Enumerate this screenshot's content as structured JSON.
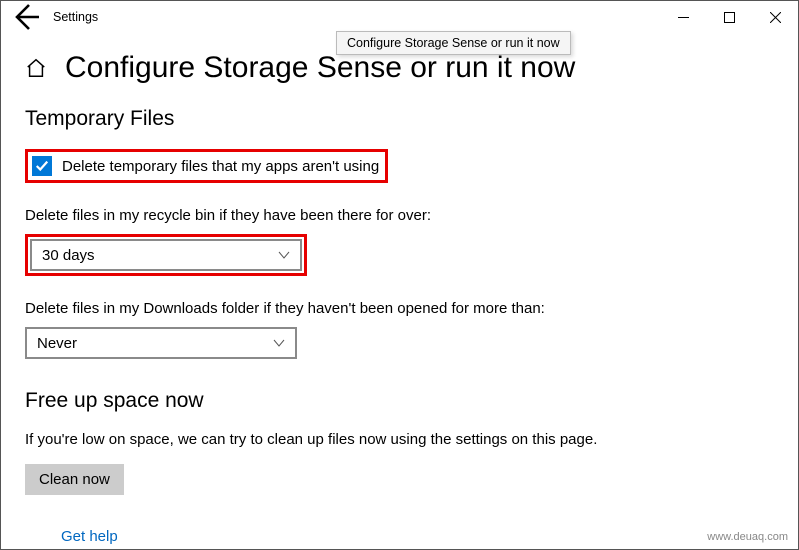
{
  "app": {
    "title": "Settings"
  },
  "tooltip": "Configure Storage Sense or run it now",
  "page": {
    "title": "Configure Storage Sense or run it now"
  },
  "sections": {
    "temp": {
      "heading": "Temporary Files",
      "checkbox_label": "Delete temporary files that my apps aren't using",
      "recycle_label": "Delete files in my recycle bin if they have been there for over:",
      "recycle_value": "30 days",
      "downloads_label": "Delete files in my Downloads folder if they haven't been opened for more than:",
      "downloads_value": "Never"
    },
    "free": {
      "heading": "Free up space now",
      "desc": "If you're low on space, we can try to clean up files now using the settings on this page.",
      "button": "Clean now"
    }
  },
  "footer": {
    "help": "Get help",
    "watermark": "www.deuaq.com"
  }
}
